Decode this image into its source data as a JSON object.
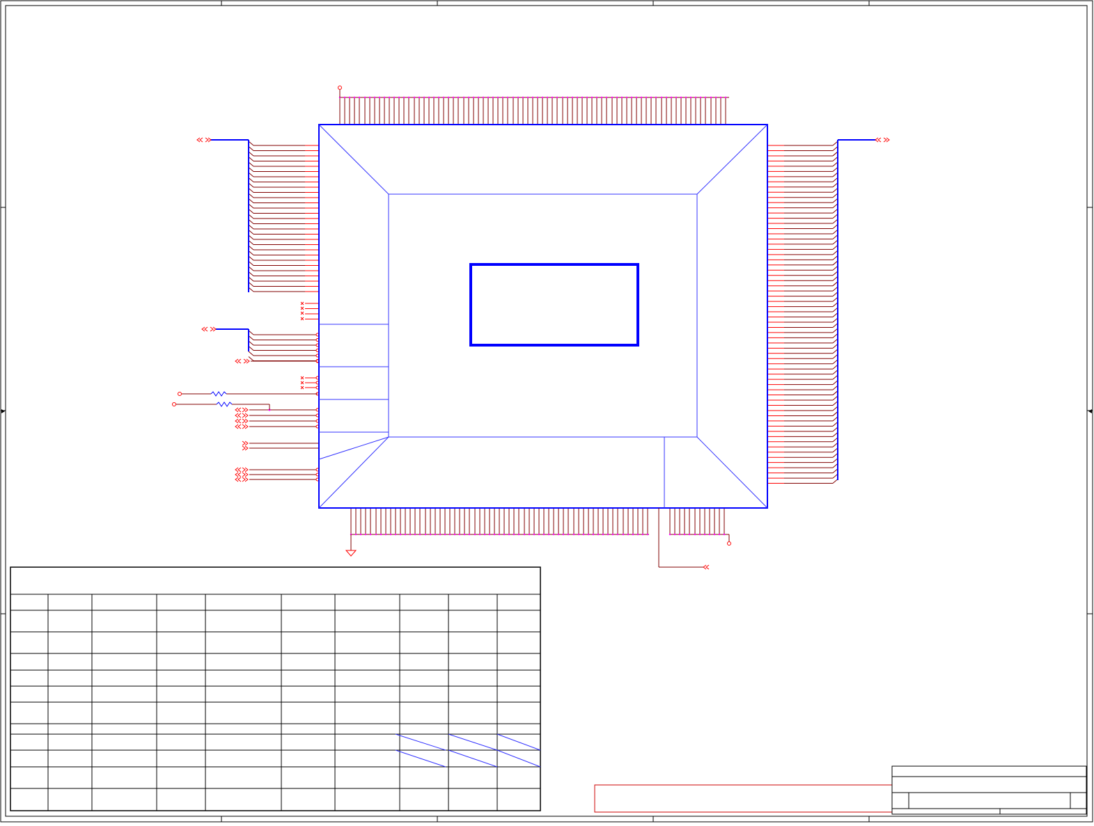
{
  "colors": {
    "border": "#000000",
    "chip_outline": "#0000ff",
    "chip_lines": "#3333ff",
    "pin_stub": "#ff0000",
    "wire": "#800000",
    "pin_dot": "#ff00ff",
    "connector": "#ff0000",
    "table_line": "#000000",
    "note_box": "#cc0000"
  },
  "icons": {
    "offpage_connector": "double-chevron-icon",
    "no_connect": "x-mark-icon",
    "ground": "ground-triangle-icon",
    "resistor": "zigzag-resistor-icon",
    "power_port": "small-circle-icon"
  },
  "sheet": {
    "title_block": {
      "title": "",
      "rev": "",
      "sheet_no": ""
    }
  },
  "table": {
    "rows": 11,
    "columns": 10
  }
}
